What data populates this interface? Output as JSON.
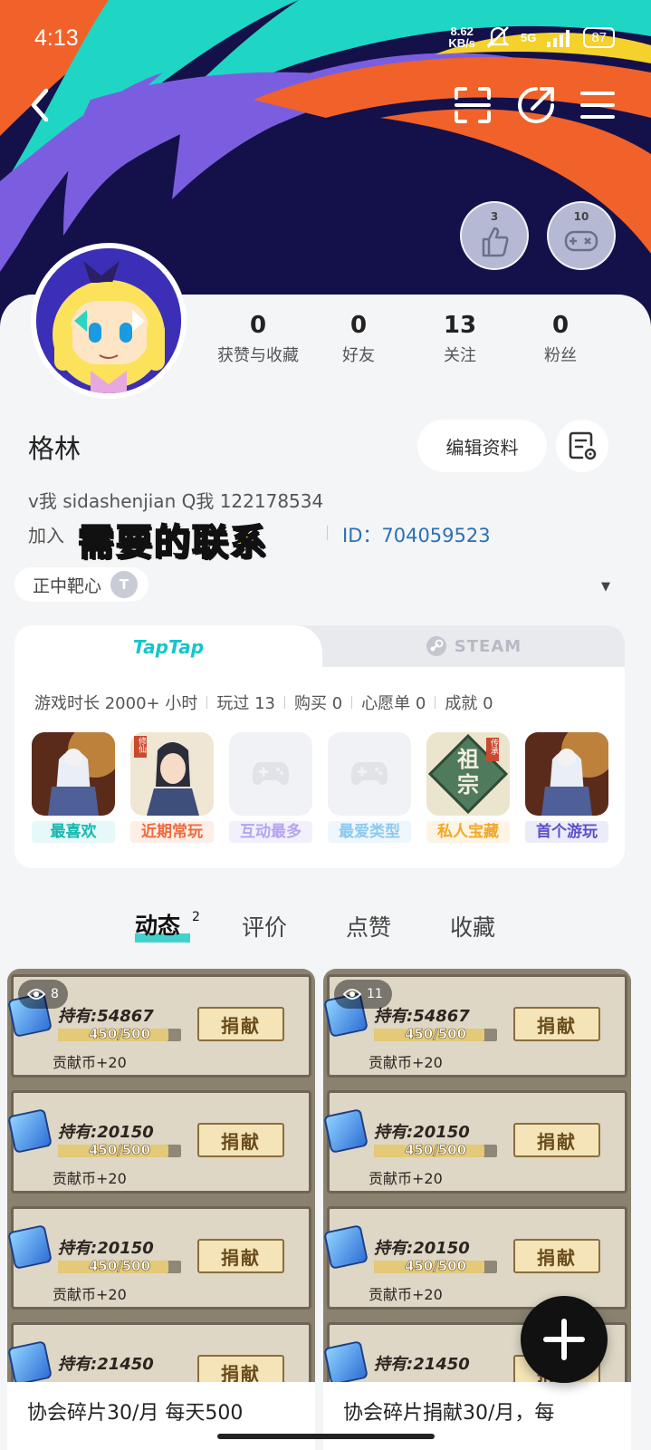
{
  "status_bar": {
    "time": "4:13",
    "net_speed_value": "8.62",
    "net_speed_unit": "KB/s",
    "network": "5G",
    "battery": "87"
  },
  "header": {
    "back_icon": "back-arrow-icon",
    "scan_icon": "scan-icon",
    "share_icon": "share-icon",
    "menu_icon": "menu-icon",
    "badges": [
      {
        "number": "3",
        "icon": "thumbs-up-icon"
      },
      {
        "number": "10",
        "icon": "gamepad-icon"
      }
    ]
  },
  "profile": {
    "stats": [
      {
        "value": "0",
        "label": "获赞与收藏"
      },
      {
        "value": "0",
        "label": "好友"
      },
      {
        "value": "13",
        "label": "关注"
      },
      {
        "value": "0",
        "label": "粉丝"
      }
    ],
    "username": "格林",
    "edit_label": "编辑资料",
    "bio": "v我 sidashenjian  Q我  122178534",
    "join_prefix": "加入",
    "id_text": "ID：704059523",
    "overlay_caption": "需要的联系",
    "title_tag": "正中靶心",
    "title_coin": "T"
  },
  "games_panel": {
    "tab_taptap": "TapTap",
    "tab_steam": "STEAM",
    "summary": {
      "playtime": "游戏时长 2000+ 小时",
      "played": "玩过 13",
      "bought": "购买 0",
      "wishlist": "心愿单 0",
      "achievements": "成就 0"
    },
    "tiles": [
      {
        "label": "最喜欢",
        "color": "#14b8b0",
        "bg": "#e6f8f7"
      },
      {
        "label": "近期常玩",
        "color": "#f06a3c",
        "bg": "#fdeee8"
      },
      {
        "label": "互动最多",
        "color": "#b4a4f0",
        "bg": "#f3f0fd"
      },
      {
        "label": "最爱类型",
        "color": "#8dc8f0",
        "bg": "#eef7fd"
      },
      {
        "label": "私人宝藏",
        "color": "#f5a623",
        "bg": "#fdf4e4"
      },
      {
        "label": "首个游玩",
        "color": "#5b4fc9",
        "bg": "#ecebfa"
      }
    ],
    "tile_art_text": "祖宗",
    "tile_art_badge": "传承",
    "tile_art_tag": "修仙"
  },
  "content_tabs": {
    "tabs": [
      "动态",
      "评价",
      "点赞",
      "收藏"
    ],
    "active_count": "2"
  },
  "feed": [
    {
      "views": "8",
      "caption": "协会碎片30/月 每天500",
      "rows": [
        {
          "hold": "持有:54867",
          "progress": "450/500",
          "reward": "贡献币+20",
          "button": "捐献"
        },
        {
          "hold": "持有:20150",
          "progress": "450/500",
          "reward": "贡献币+20",
          "button": "捐献"
        },
        {
          "hold": "持有:20150",
          "progress": "450/500",
          "reward": "贡献币+20",
          "button": "捐献"
        },
        {
          "hold": "持有:21450",
          "progress": "",
          "reward": "",
          "button": "捐献"
        }
      ]
    },
    {
      "views": "11",
      "caption": "协会碎片捐献30/月，每",
      "rows": [
        {
          "hold": "持有:54867",
          "progress": "450/500",
          "reward": "贡献币+20",
          "button": "捐献"
        },
        {
          "hold": "持有:20150",
          "progress": "450/500",
          "reward": "贡献币+20",
          "button": "捐献"
        },
        {
          "hold": "持有:20150",
          "progress": "450/500",
          "reward": "贡献币+20",
          "button": "捐献"
        },
        {
          "hold": "持有:21450",
          "progress": "",
          "reward": "",
          "button": "捐献"
        }
      ]
    }
  ],
  "progress_fill": 0.9,
  "fab_icon": "plus-icon"
}
